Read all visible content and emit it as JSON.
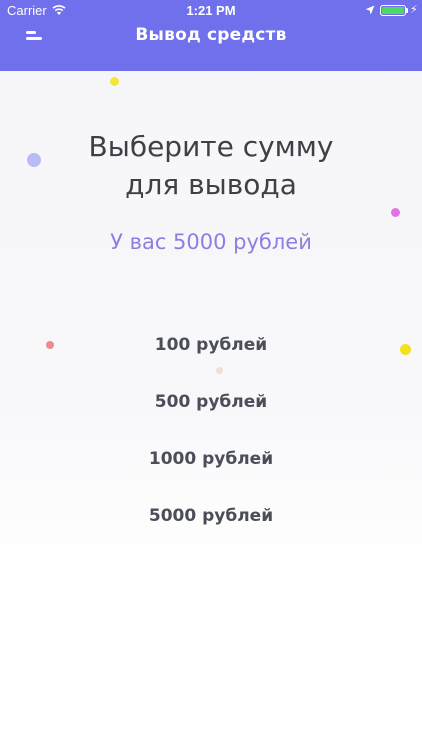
{
  "status_bar": {
    "carrier": "Carrier",
    "time": "1:21 PM",
    "battery_color": "#4cd964"
  },
  "nav": {
    "title": "Вывод средств",
    "menu_icon": "menu-icon",
    "background": "#7070ec"
  },
  "main": {
    "heading_line1": "Выберите сумму",
    "heading_line2": "для вывода",
    "balance_text": "У вас 5000 рублей",
    "balance_color": "#8c7fe0",
    "options": [
      {
        "label": "100 рублей"
      },
      {
        "label": "500 рублей"
      },
      {
        "label": "1000 рублей"
      },
      {
        "label": "5000 рублей"
      }
    ]
  }
}
